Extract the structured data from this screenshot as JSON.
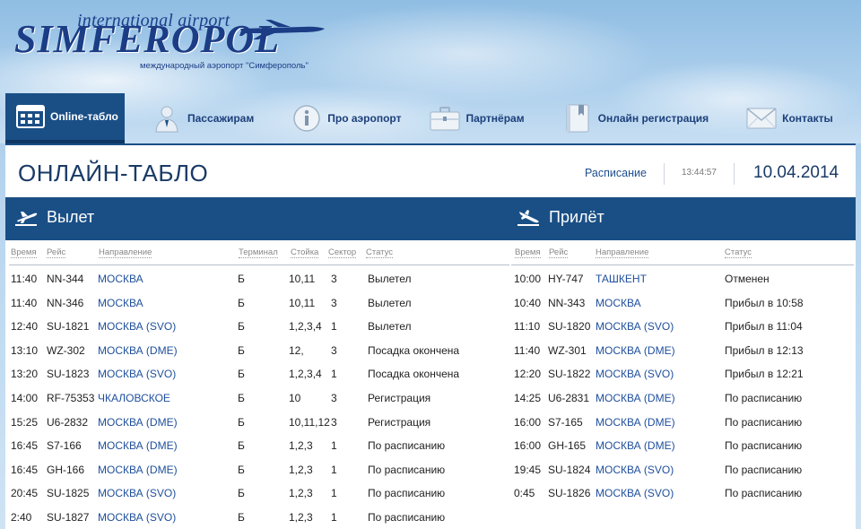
{
  "logo": {
    "top_text": "international airport",
    "main_text": "SIMFEROPOL",
    "subtitle": "международный аэропорт \"Симферополь\""
  },
  "nav": [
    {
      "label": "Online-табло",
      "icon": "board-icon",
      "active": true
    },
    {
      "label": "Пассажирам",
      "icon": "passenger-icon",
      "active": false
    },
    {
      "label": "Про аэропорт",
      "icon": "info-icon",
      "active": false
    },
    {
      "label": "Партнёрам",
      "icon": "briefcase-icon",
      "active": false
    },
    {
      "label": "Онлайн регистрация",
      "icon": "bookmark-icon",
      "active": false
    },
    {
      "label": "Контакты",
      "icon": "envelope-icon",
      "active": false
    }
  ],
  "page": {
    "title": "ОНЛАЙН-ТАБЛО",
    "schedule_link": "Расписание",
    "time": "13:44:57",
    "date": "10.04.2014"
  },
  "departures": {
    "title": "Вылет",
    "columns": [
      "Время",
      "Рейс",
      "Направление",
      "Терминал",
      "Стойка",
      "Сектор",
      "Статус"
    ],
    "rows": [
      [
        "11:40",
        "NN-344",
        "МОСКВА",
        "Б",
        "10,11",
        "3",
        "Вылетел"
      ],
      [
        "11:40",
        "NN-346",
        "МОСКВА",
        "Б",
        "10,11",
        "3",
        "Вылетел"
      ],
      [
        "12:40",
        "SU-1821",
        "МОСКВА (SVO)",
        "Б",
        "1,2,3,4",
        "1",
        "Вылетел"
      ],
      [
        "13:10",
        "WZ-302",
        "МОСКВА (DME)",
        "Б",
        "12,",
        "3",
        "Посадка окончена"
      ],
      [
        "13:20",
        "SU-1823",
        "МОСКВА (SVO)",
        "Б",
        "1,2,3,4",
        "1",
        "Посадка окончена"
      ],
      [
        "14:00",
        "RF-75353",
        "ЧКАЛОВСКОЕ",
        "Б",
        "10",
        "3",
        "Регистрация"
      ],
      [
        "15:25",
        "U6-2832",
        "МОСКВА (DME)",
        "Б",
        "10,11,12",
        "3",
        "Регистрация"
      ],
      [
        "16:45",
        "S7-166",
        "МОСКВА (DME)",
        "Б",
        "1,2,3",
        "1",
        "По расписанию"
      ],
      [
        "16:45",
        "GH-166",
        "МОСКВА (DME)",
        "Б",
        "1,2,3",
        "1",
        "По расписанию"
      ],
      [
        "20:45",
        "SU-1825",
        "МОСКВА (SVO)",
        "Б",
        "1,2,3",
        "1",
        "По расписанию"
      ],
      [
        "2:40",
        "SU-1827",
        "МОСКВА (SVO)",
        "Б",
        "1,2,3",
        "1",
        "По расписанию"
      ]
    ]
  },
  "arrivals": {
    "title": "Прилёт",
    "columns": [
      "Время",
      "Рейс",
      "Направление",
      "Статус"
    ],
    "rows": [
      [
        "10:00",
        "HY-747",
        "ТАШКЕНТ",
        "Отменен"
      ],
      [
        "10:40",
        "NN-343",
        "МОСКВА",
        "Прибыл в 10:58"
      ],
      [
        "11:10",
        "SU-1820",
        "МОСКВА (SVO)",
        "Прибыл в 11:04"
      ],
      [
        "11:40",
        "WZ-301",
        "МОСКВА (DME)",
        "Прибыл в 12:13"
      ],
      [
        "12:20",
        "SU-1822",
        "МОСКВА (SVO)",
        "Прибыл в 12:21"
      ],
      [
        "14:25",
        "U6-2831",
        "МОСКВА (DME)",
        "По расписанию"
      ],
      [
        "16:00",
        "S7-165",
        "МОСКВА (DME)",
        "По расписанию"
      ],
      [
        "16:00",
        "GH-165",
        "МОСКВА (DME)",
        "По расписанию"
      ],
      [
        "19:45",
        "SU-1824",
        "МОСКВА (SVO)",
        "По расписанию"
      ],
      [
        "0:45",
        "SU-1826",
        "МОСКВА (SVO)",
        "По расписанию"
      ]
    ]
  },
  "colors": {
    "primary": "#1a4f86",
    "link": "#1e4f9c",
    "title": "#1a3a66"
  }
}
